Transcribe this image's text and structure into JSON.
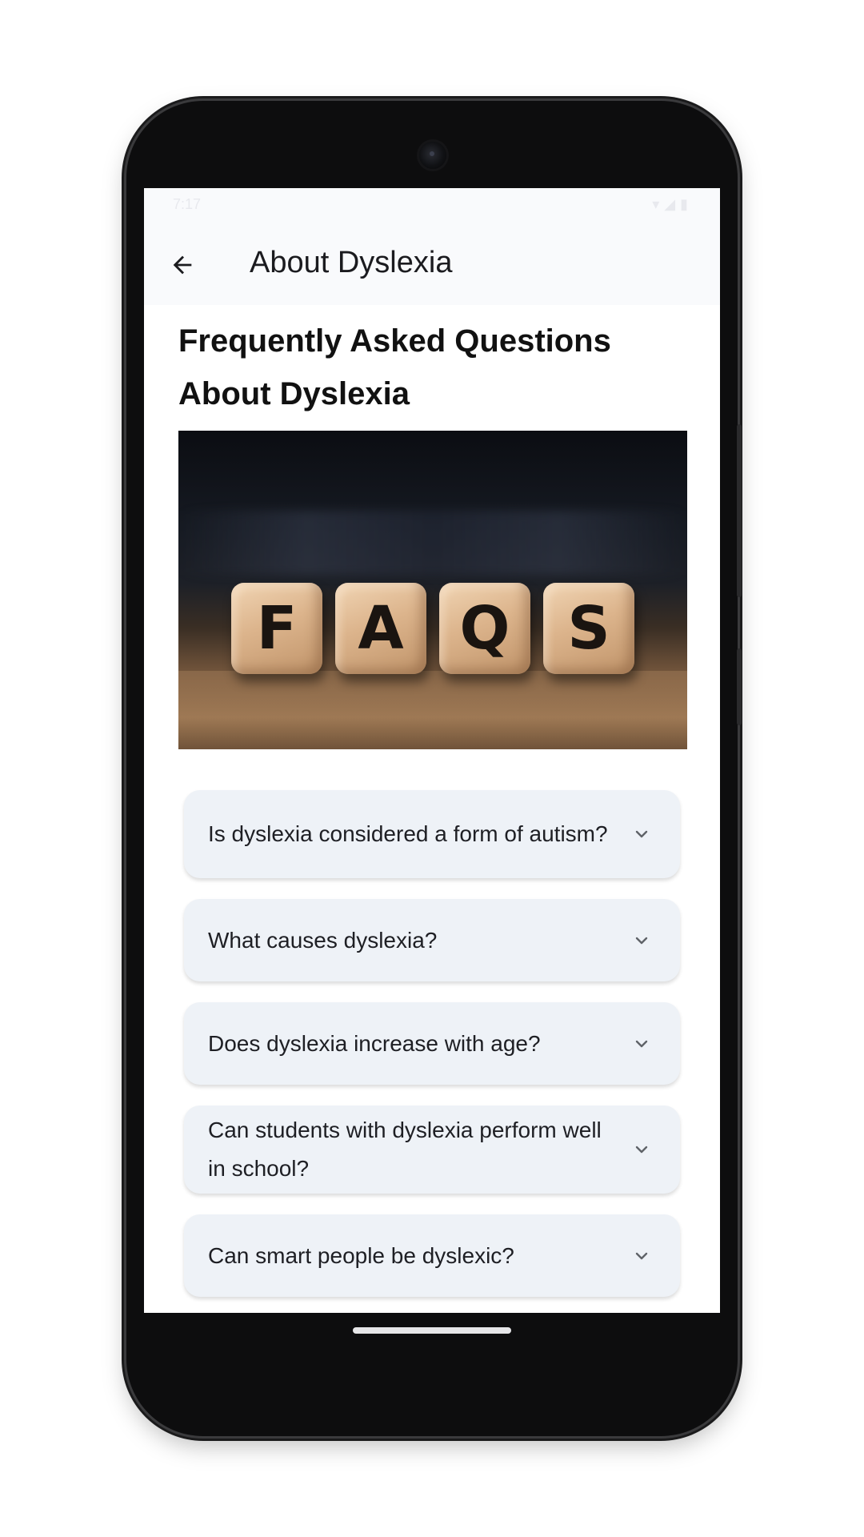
{
  "status_bar": {
    "time": "7:17",
    "icons": [
      "wifi-icon",
      "signal-icon",
      "battery-icon"
    ]
  },
  "app_bar": {
    "back_icon": "arrow-left-icon",
    "title": "About Dyslexia"
  },
  "content": {
    "heading": "Frequently Asked Questions About Dyslexia",
    "hero_image": {
      "letters": [
        "F",
        "A",
        "Q",
        "S"
      ]
    },
    "faqs": [
      {
        "question": "Is dyslexia considered a form of autism?",
        "expand_icon": "chevron-down-icon"
      },
      {
        "question": "What causes dyslexia?",
        "expand_icon": "chevron-down-icon"
      },
      {
        "question": "Does dyslexia increase with age?",
        "expand_icon": "chevron-down-icon"
      },
      {
        "question": "Can students with dyslexia perform well in school?",
        "expand_icon": "chevron-down-icon"
      },
      {
        "question": "Can smart people be dyslexic?",
        "expand_icon": "chevron-down-icon"
      }
    ]
  },
  "colors": {
    "app_bar_bg": "#f9fafc",
    "card_bg": "#eef2f7",
    "text_primary": "#111111",
    "icon": "#5f6368"
  }
}
